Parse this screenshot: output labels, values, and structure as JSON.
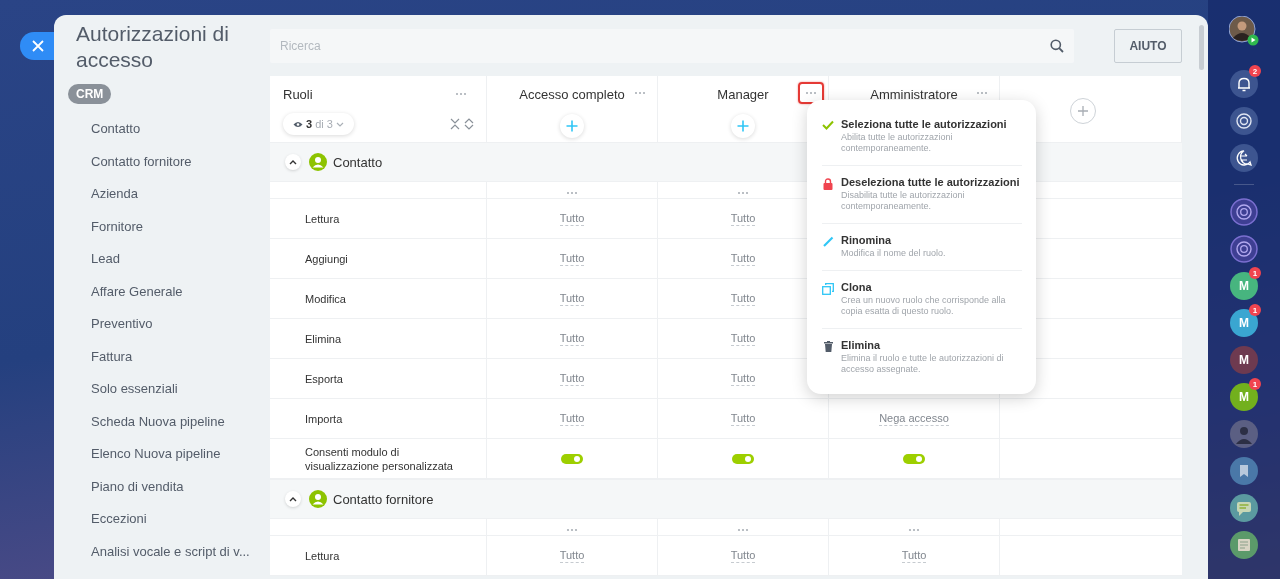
{
  "title": "Autorizzazioni di accesso",
  "sidebar": {
    "section": "CRM",
    "items": [
      "Contatto",
      "Contatto fornitore",
      "Azienda",
      "Fornitore",
      "Lead",
      "Affare Generale",
      "Preventivo",
      "Fattura",
      "Solo essenziali",
      "Scheda Nuova pipeline",
      "Elenco Nuova pipeline",
      "Piano di vendita",
      "Eccezioni",
      "Analisi vocale e script di v..."
    ]
  },
  "search": {
    "placeholder": "Ricerca"
  },
  "help_button": "AIUTO",
  "table": {
    "columns": [
      {
        "label": "Ruoli",
        "menu_open": false
      },
      {
        "label": "Accesso completo",
        "menu_open": false
      },
      {
        "label": "Manager",
        "menu_open": true
      },
      {
        "label": "Amministratore",
        "menu_open": false
      }
    ],
    "role_filter": {
      "shown": "3",
      "total": "di 3"
    },
    "sections": [
      {
        "title": "Contatto",
        "expanded": true,
        "rows": [
          {
            "label": "Lettura",
            "kind": "select",
            "values": [
              "Tutto",
              "Tutto"
            ]
          },
          {
            "label": "Aggiungi",
            "kind": "select",
            "values": [
              "Tutto",
              "Tutto"
            ]
          },
          {
            "label": "Modifica",
            "kind": "select",
            "values": [
              "Tutto",
              "Tutto"
            ]
          },
          {
            "label": "Elimina",
            "kind": "select",
            "values": [
              "Tutto",
              "Tutto"
            ]
          },
          {
            "label": "Esporta",
            "kind": "select",
            "values": [
              "Tutto",
              "Tutto"
            ]
          },
          {
            "label": "Importa",
            "kind": "select",
            "values": [
              "Tutto",
              "Tutto",
              "Nega accesso"
            ]
          },
          {
            "label": "Consenti modulo di visualizzazione personalizzata",
            "kind": "toggle",
            "values": [
              true,
              true,
              true
            ]
          }
        ]
      },
      {
        "title": "Contatto fornitore",
        "expanded": true,
        "rows": [
          {
            "label": "Lettura",
            "kind": "select",
            "values": [
              "Tutto",
              "Tutto",
              "Tutto"
            ]
          }
        ]
      }
    ]
  },
  "context_menu": {
    "items": [
      {
        "kind": "check",
        "title": "Seleziona tutte le autorizzazioni",
        "description": "Abilita tutte le autorizzazioni contemporaneamente."
      },
      {
        "kind": "lock",
        "title": "Deseleziona tutte le autorizzazioni",
        "description": "Disabilita tutte le autorizzazioni contemporaneamente."
      },
      {
        "kind": "pencil",
        "title": "Rinomina",
        "description": "Modifica il nome del ruolo."
      },
      {
        "kind": "copy",
        "title": "Clona",
        "description": "Crea un nuovo ruolo che corrisponde alla copia esatta di questo ruolo."
      },
      {
        "kind": "trash",
        "title": "Elimina",
        "description": "Elimina il ruolo e tutte le autorizzazioni di accesso assegnate."
      }
    ]
  },
  "right_rail": [
    {
      "kind": "user"
    },
    {
      "kind": "bell",
      "badge": "2"
    },
    {
      "kind": "target"
    },
    {
      "kind": "swap"
    },
    {
      "kind": "divider"
    },
    {
      "kind": "channel"
    },
    {
      "kind": "channel"
    },
    {
      "kind": "letter",
      "letter": "M",
      "color": "#47b57f",
      "badge": "1"
    },
    {
      "kind": "letter",
      "letter": "M",
      "color": "#3aa6d1",
      "badge": "1"
    },
    {
      "kind": "letter",
      "letter": "M",
      "color": "#6e3a50"
    },
    {
      "kind": "letter",
      "letter": "M",
      "color": "#72b01d",
      "badge": "1"
    },
    {
      "kind": "group"
    },
    {
      "kind": "bookmark"
    },
    {
      "kind": "chat"
    },
    {
      "kind": "news"
    }
  ]
}
